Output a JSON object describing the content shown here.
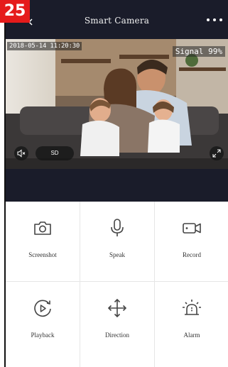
{
  "page_badge": "25",
  "header": {
    "title": "Smart Camera"
  },
  "video": {
    "timestamp": "2018-05-14 11:20:30",
    "signal": "Signal 99%",
    "sd_label": "SD"
  },
  "controls": [
    {
      "label": "Screenshot",
      "icon": "camera-icon"
    },
    {
      "label": "Speak",
      "icon": "microphone-icon"
    },
    {
      "label": "Record",
      "icon": "video-camera-icon"
    },
    {
      "label": "Playback",
      "icon": "playback-icon"
    },
    {
      "label": "Direction",
      "icon": "direction-arrows-icon"
    },
    {
      "label": "Alarm",
      "icon": "alarm-siren-icon"
    }
  ],
  "colors": {
    "header_bg": "#1a1c2a",
    "badge_bg": "#e51b1b",
    "icon_color": "#444444"
  }
}
